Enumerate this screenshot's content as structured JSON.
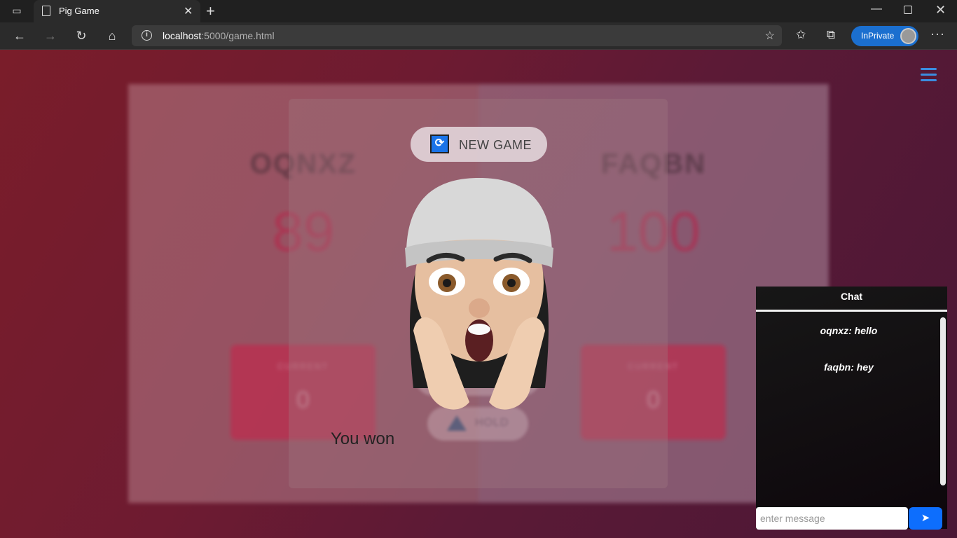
{
  "browser": {
    "tab_title": "Pig Game",
    "url_host": "localhost",
    "url_rest": ":5000/game.html",
    "inprivate_label": "InPrivate",
    "icons": {
      "tab_list": "tab-list-icon",
      "page": "page-icon",
      "close_tab": "close-icon",
      "new_tab": "plus-icon",
      "minimize": "minimize-icon",
      "maximize": "restore-icon",
      "close_window": "close-icon",
      "back": "back-arrow-icon",
      "forward": "forward-arrow-icon",
      "refresh": "refresh-icon",
      "home": "home-icon",
      "site_info": "info-icon",
      "add_favorite": "star-add-icon",
      "favorites": "favorites-icon",
      "collections": "collections-icon",
      "more": "more-icon"
    }
  },
  "game": {
    "players": [
      {
        "name": "OQNXZ",
        "score": "89",
        "current_label": "CURRENT",
        "current_value": "0"
      },
      {
        "name": "FAQBN",
        "score": "100",
        "current_label": "CURRENT",
        "current_value": "0"
      }
    ],
    "new_game_label": "NEW GAME",
    "hold_label": "HOLD",
    "result_text": "You won"
  },
  "chat": {
    "title": "Chat",
    "messages": [
      {
        "text": "oqnxz: hello"
      },
      {
        "text": "faqbn: hey"
      }
    ],
    "input_placeholder": "enter message",
    "send_icon": "paper-plane-icon"
  },
  "colors": {
    "accent": "#0d6efd",
    "menu": "#3b8de0",
    "score": "#be1e46"
  }
}
